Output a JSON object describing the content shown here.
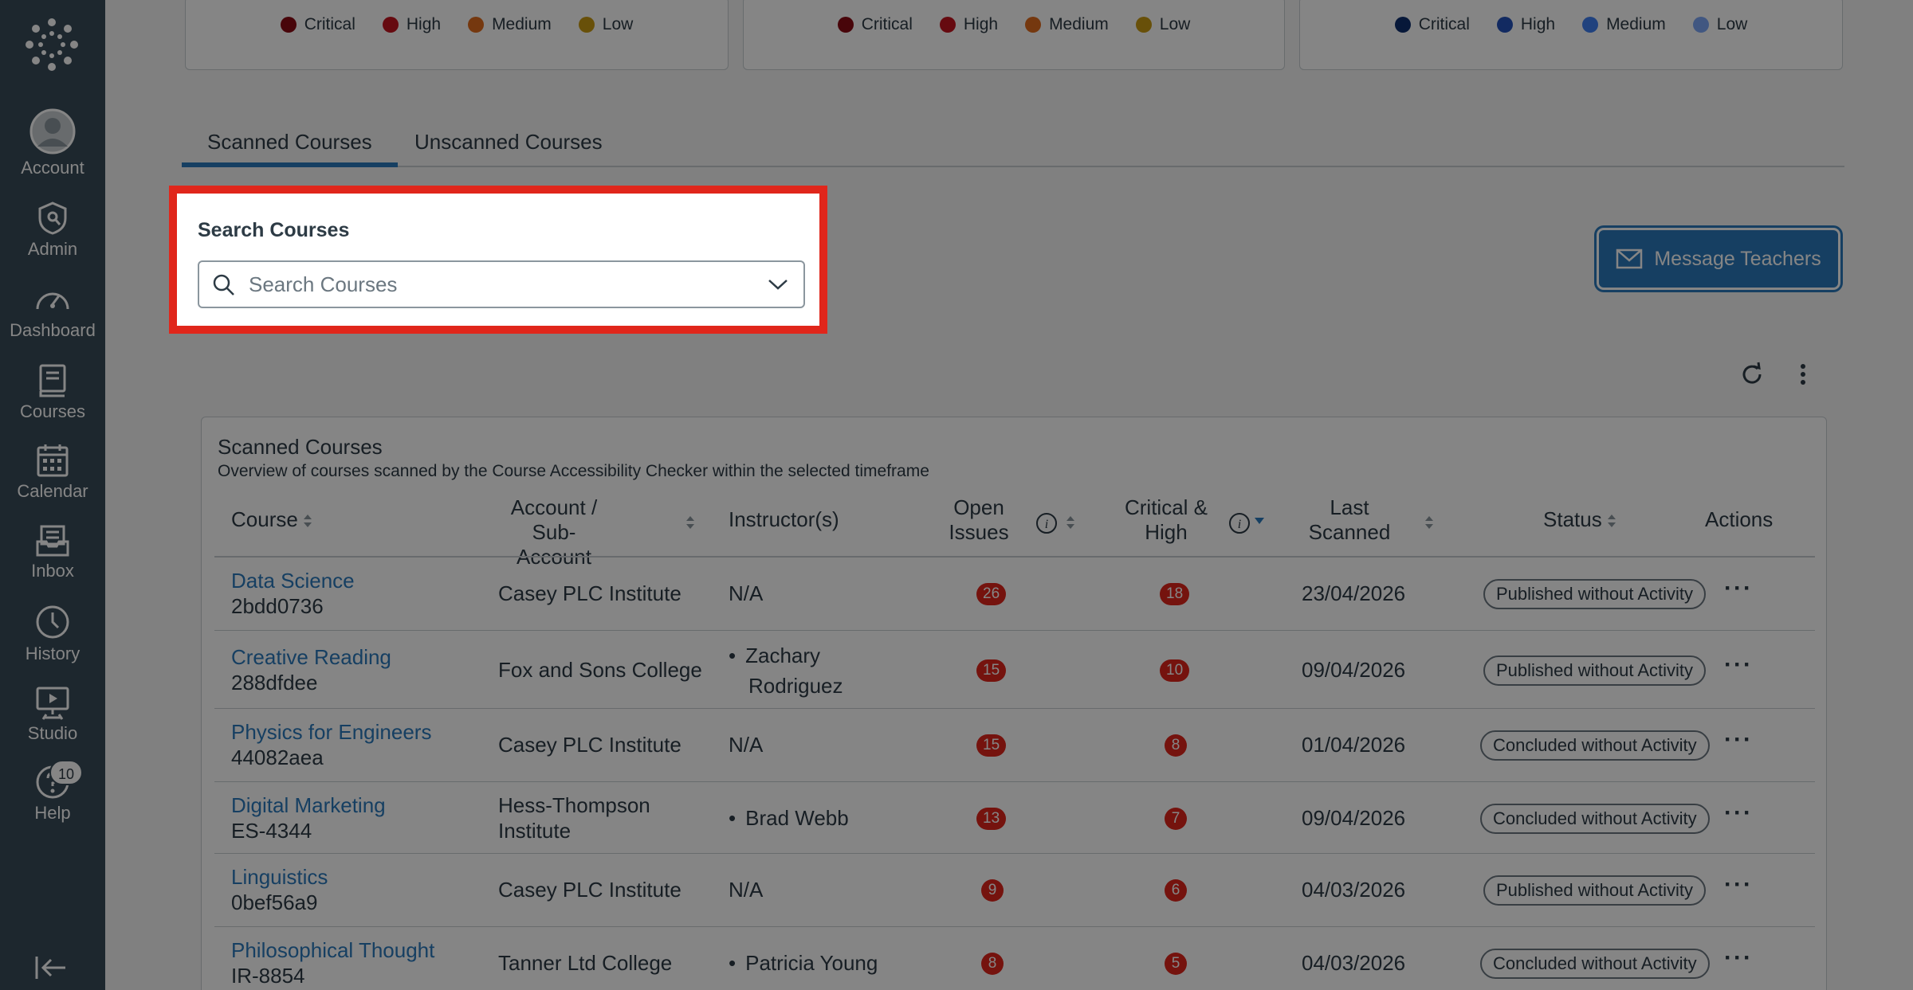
{
  "sidebar": {
    "items": [
      {
        "label": "Account",
        "icon": "account-icon"
      },
      {
        "label": "Admin",
        "icon": "admin-icon"
      },
      {
        "label": "Dashboard",
        "icon": "dashboard-icon"
      },
      {
        "label": "Courses",
        "icon": "courses-icon"
      },
      {
        "label": "Calendar",
        "icon": "calendar-icon"
      },
      {
        "label": "Inbox",
        "icon": "inbox-icon"
      },
      {
        "label": "History",
        "icon": "history-icon"
      },
      {
        "label": "Studio",
        "icon": "studio-icon"
      },
      {
        "label": "Help",
        "icon": "help-icon"
      }
    ],
    "help_badge": "10"
  },
  "legends": [
    {
      "items": [
        {
          "label": "Critical",
          "color": "#8a0b14"
        },
        {
          "label": "High",
          "color": "#c4141f"
        },
        {
          "label": "Medium",
          "color": "#e16b1e"
        },
        {
          "label": "Low",
          "color": "#c89a12"
        }
      ]
    },
    {
      "items": [
        {
          "label": "Critical",
          "color": "#8a0b14"
        },
        {
          "label": "High",
          "color": "#c4141f"
        },
        {
          "label": "Medium",
          "color": "#e16b1e"
        },
        {
          "label": "Low",
          "color": "#c89a12"
        }
      ]
    },
    {
      "items": [
        {
          "label": "Critical",
          "color": "#0f2f6e"
        },
        {
          "label": "High",
          "color": "#2352ba"
        },
        {
          "label": "Medium",
          "color": "#3f7ff2"
        },
        {
          "label": "Low",
          "color": "#7ea8f8"
        }
      ]
    }
  ],
  "tabs": [
    {
      "label": "Scanned Courses",
      "active": true
    },
    {
      "label": "Unscanned Courses",
      "active": false
    }
  ],
  "search": {
    "title": "Search Courses",
    "placeholder": "Search Courses"
  },
  "message_button": {
    "label": "Message Teachers"
  },
  "table": {
    "title": "Scanned Courses",
    "subtitle": "Overview of courses scanned by the Course Accessibility Checker within the selected timeframe",
    "headers": {
      "course": "Course",
      "account_1": "Account / Sub-",
      "account_2": "Account",
      "instructors": "Instructor(s)",
      "open_1": "Open",
      "open_2": "Issues",
      "crit_1": "Critical &",
      "crit_2": "High",
      "last_1": "Last",
      "last_2": "Scanned",
      "status": "Status",
      "actions": "Actions"
    },
    "rows": [
      {
        "name": "Data Science",
        "code": "2bdd0736",
        "account": "Casey PLC Institute",
        "account2": "",
        "instructor": "N/A",
        "instructor2": "",
        "bullet": false,
        "open": "26",
        "critical": "18",
        "scanned": "23/04/2026",
        "status": "Published without Activity"
      },
      {
        "name": "Creative Reading",
        "code": "288dfdee",
        "account": "Fox and Sons College",
        "account2": "",
        "instructor": "Zachary",
        "instructor2": "Rodriguez",
        "bullet": true,
        "open": "15",
        "critical": "10",
        "scanned": "09/04/2026",
        "status": "Published without Activity"
      },
      {
        "name": "Physics for Engineers",
        "code": "44082aea",
        "account": "Casey PLC Institute",
        "account2": "",
        "instructor": "N/A",
        "instructor2": "",
        "bullet": false,
        "open": "15",
        "critical": "8",
        "scanned": "01/04/2026",
        "status": "Concluded without Activity"
      },
      {
        "name": "Digital Marketing",
        "code": "ES-4344",
        "account": "Hess-Thompson",
        "account2": "Institute",
        "instructor": "Brad Webb",
        "instructor2": "",
        "bullet": true,
        "open": "13",
        "critical": "7",
        "scanned": "09/04/2026",
        "status": "Concluded without Activity"
      },
      {
        "name": "Linguistics",
        "code": "0bef56a9",
        "account": "Casey PLC Institute",
        "account2": "",
        "instructor": "N/A",
        "instructor2": "",
        "bullet": false,
        "open": "9",
        "critical": "6",
        "scanned": "04/03/2026",
        "status": "Published without Activity"
      },
      {
        "name": "Philosophical Thought",
        "code": "IR-8854",
        "account": "Tanner Ltd College",
        "account2": "",
        "instructor": "Patricia Young",
        "instructor2": "",
        "bullet": true,
        "open": "8",
        "critical": "5",
        "scanned": "04/03/2026",
        "status": "Concluded without Activity"
      }
    ]
  }
}
